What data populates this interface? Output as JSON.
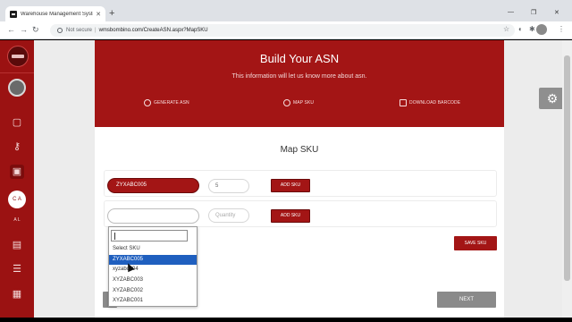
{
  "browser": {
    "tab_title": "Warehouse Management Syste",
    "new_tab": "+",
    "address_security": "Not secure",
    "address_separator": "|",
    "url": "wmsbombino.com/CreateASN.aspx?MapSKU"
  },
  "sidebar": {
    "user_initials": "C A",
    "user_label": "A L"
  },
  "hero": {
    "title": "Build Your ASN",
    "subtitle": "This information will let us know more about asn.",
    "steps": [
      {
        "label": "GENERATE ASN",
        "icon": "clock-icon"
      },
      {
        "label": "MAP SKU",
        "icon": "settings-icon"
      },
      {
        "label": "DOWNLOAD BARCODE",
        "icon": "barcode-icon"
      }
    ]
  },
  "map_sku": {
    "title": "Map SKU",
    "rows": [
      {
        "sku": "ZYXABC005",
        "quantity": "5",
        "add_label": "ADD SKU"
      },
      {
        "sku": "",
        "quantity_placeholder": "Quantity",
        "add_label": "ADD SKU"
      }
    ],
    "save_label": "SAVE SKU",
    "next_label": "NEXT"
  },
  "dropdown": {
    "search_value": "",
    "options": [
      "Select SKU",
      "ZYXABC005",
      "xyzabc004",
      "XYZABC003",
      "XYZABC002",
      "XYZABC001"
    ],
    "highlighted_index": 1
  },
  "colors": {
    "brand_red": "#a31515",
    "highlight_blue": "#1f5fbf",
    "button_gray": "#8a8a8a"
  }
}
